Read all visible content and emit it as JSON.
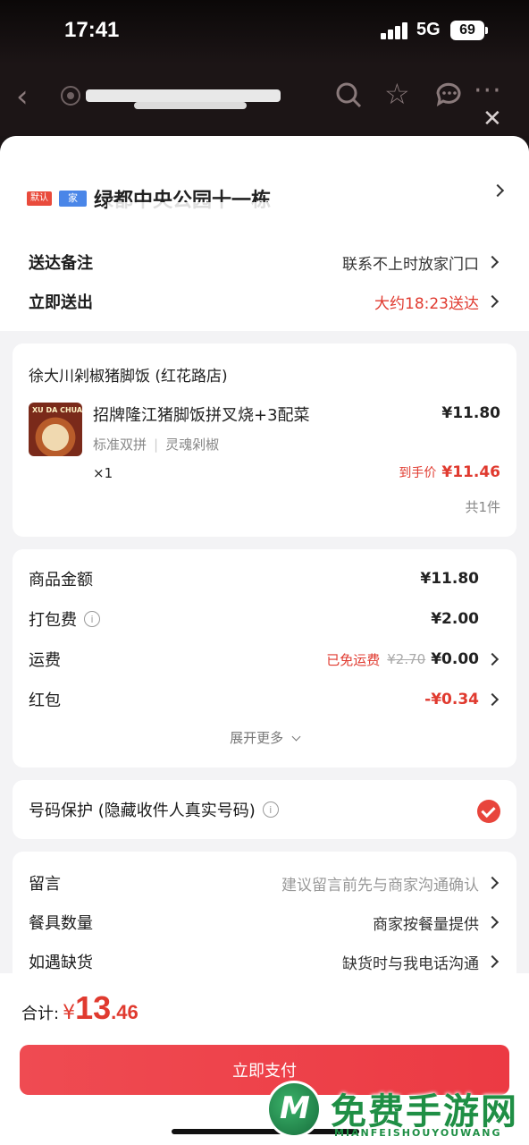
{
  "status": {
    "time": "17:41",
    "network": "5G",
    "battery": "69"
  },
  "header": {
    "title_partial": "绿都中央公园十一栋",
    "icons": [
      "back-icon",
      "location-icon",
      "search-icon",
      "star-icon",
      "chat-icon",
      "more-icon",
      "close-icon"
    ]
  },
  "address": {
    "tag_red": "默认",
    "tag_blue": "家",
    "text": "绿都中央公园十一栋"
  },
  "delivery": {
    "remark_label": "送达备注",
    "remark_value": "联系不上时放家门口",
    "send_label": "立即送出",
    "send_value": "大约18:23送达"
  },
  "order": {
    "store": "徐大川剁椒猪脚饭 (红花路店)",
    "thumb_text": "XU DA CHUAN",
    "item_name": "招牌隆江猪脚饭拼叉烧+3配菜",
    "item_spec1": "标准双拼",
    "item_spec2": "灵魂剁椒",
    "item_qty": "×1",
    "item_price": "¥11.80",
    "final_label": "到手价",
    "final_price": "¥11.46",
    "count": "共1件"
  },
  "fees": {
    "goods_label": "商品金额",
    "goods_value": "¥11.80",
    "pack_label": "打包费",
    "pack_value": "¥2.00",
    "ship_label": "运费",
    "ship_free": "已免运费",
    "ship_orig": "¥2.70",
    "ship_value": "¥0.00",
    "redpack_label": "红包",
    "redpack_value": "-¥0.34",
    "expand": "展开更多"
  },
  "privacy": {
    "label": "号码保护 (隐藏收件人真实号码)",
    "checked": true
  },
  "extras": {
    "msg_label": "留言",
    "msg_value": "建议留言前先与商家沟通确认",
    "utensil_label": "餐具数量",
    "utensil_value": "商家按餐量提供",
    "oos_label": "如遇缺货",
    "oos_value": "缺货时与我电话沟通"
  },
  "footer": {
    "total_label": "合计:",
    "currency": "¥",
    "total_int": "13",
    "total_dec": ".46",
    "pay_button": "立即支付"
  },
  "watermark": {
    "title": "免费手游网",
    "subtitle": "MIANFEISHOUYOUWANG",
    "logo": "M"
  },
  "colors": {
    "accent": "#e03a2f",
    "pay_button": "#ec3a43",
    "background": "#f3f3f5"
  }
}
